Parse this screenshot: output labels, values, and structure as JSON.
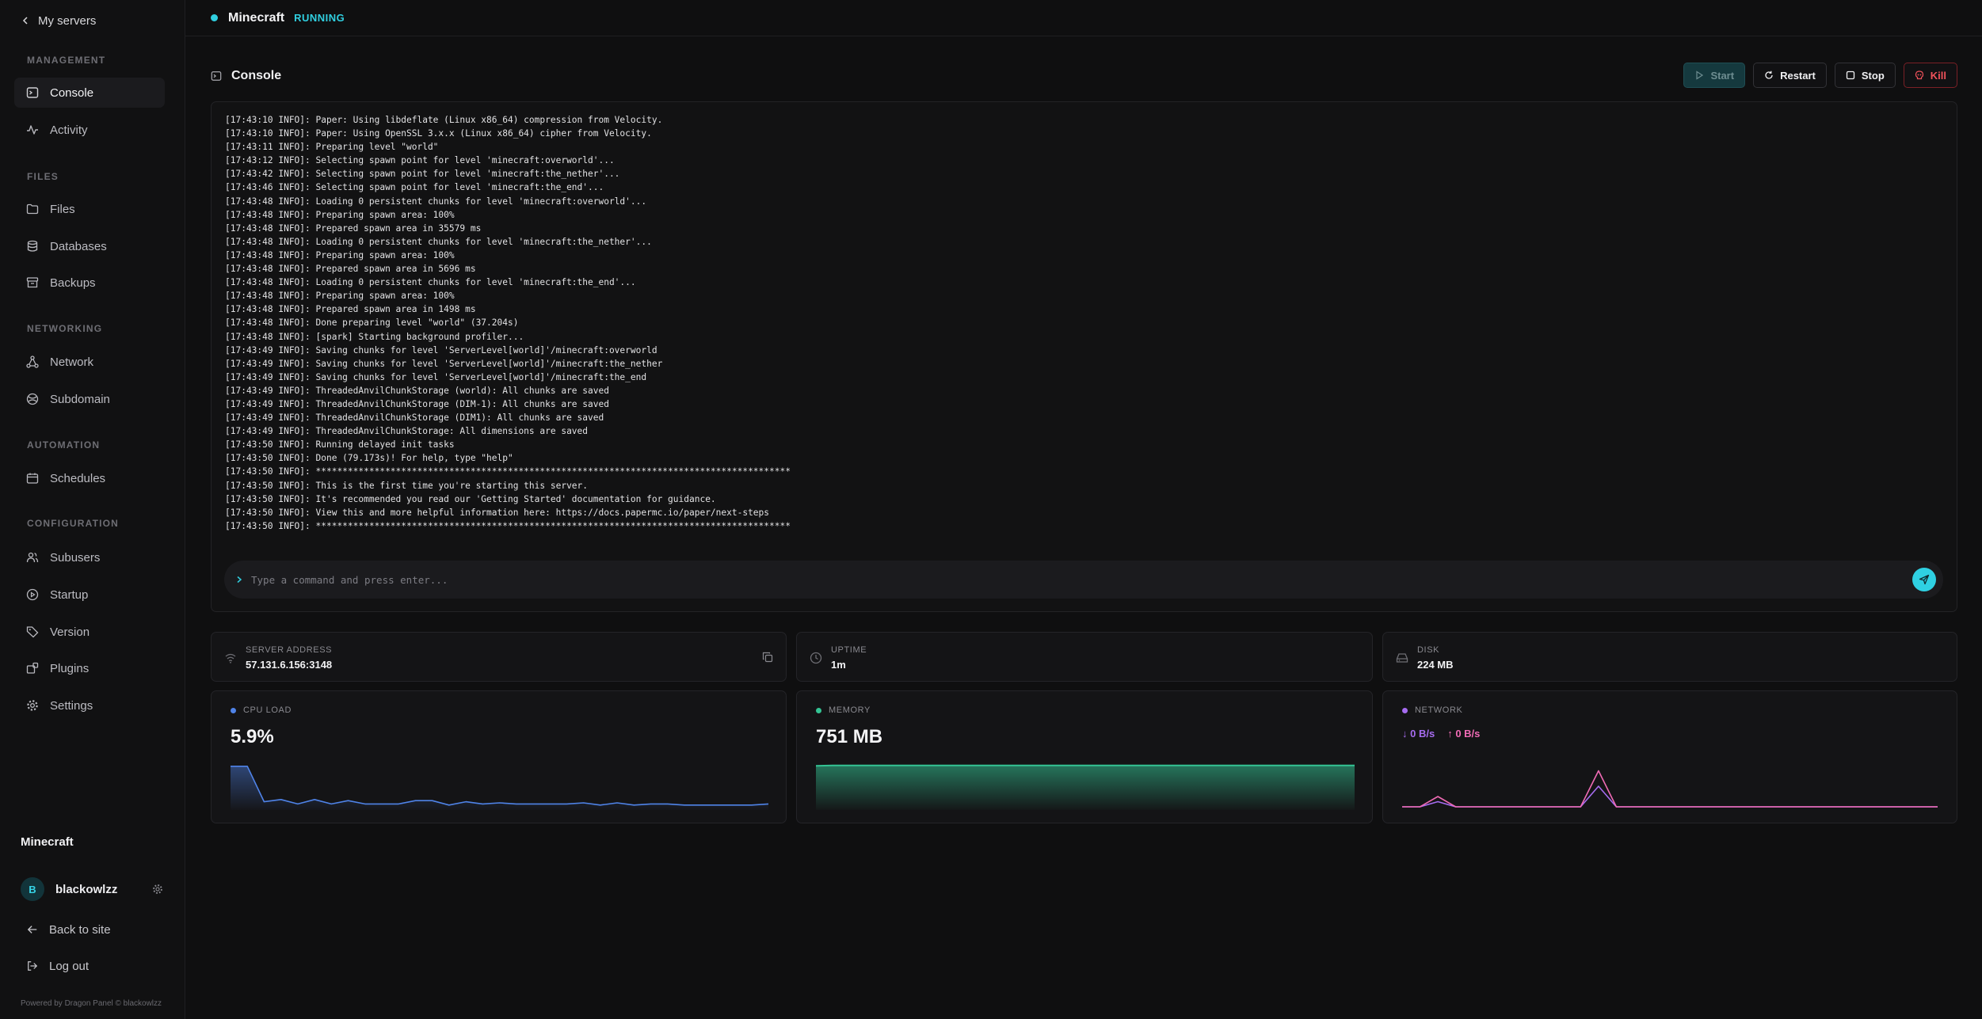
{
  "sidebar": {
    "back_label": "My servers",
    "sections": {
      "management": "MANAGEMENT",
      "files": "FILES",
      "networking": "NETWORKING",
      "automation": "AUTOMATION",
      "configuration": "CONFIGURATION"
    },
    "items": {
      "console": "Console",
      "activity": "Activity",
      "files": "Files",
      "databases": "Databases",
      "backups": "Backups",
      "network": "Network",
      "subdomain": "Subdomain",
      "schedules": "Schedules",
      "subusers": "Subusers",
      "startup": "Startup",
      "version": "Version",
      "plugins": "Plugins",
      "settings": "Settings"
    },
    "server_name": "Minecraft",
    "user": {
      "initial": "B",
      "name": "blackowlzz"
    },
    "back_to_site": "Back to site",
    "logout": "Log out",
    "powered_by": "Powered by Dragon Panel © blackowlzz"
  },
  "topbar": {
    "title": "Minecraft",
    "status": "RUNNING",
    "status_color": "#30cfe0"
  },
  "console": {
    "title": "Console",
    "buttons": {
      "start": "Start",
      "restart": "Restart",
      "stop": "Stop",
      "kill": "Kill"
    },
    "log": [
      "[17:43:10 INFO]: Paper: Using libdeflate (Linux x86_64) compression from Velocity.",
      "[17:43:10 INFO]: Paper: Using OpenSSL 3.x.x (Linux x86_64) cipher from Velocity.",
      "[17:43:11 INFO]: Preparing level \"world\"",
      "[17:43:12 INFO]: Selecting spawn point for level 'minecraft:overworld'...",
      "[17:43:42 INFO]: Selecting spawn point for level 'minecraft:the_nether'...",
      "[17:43:46 INFO]: Selecting spawn point for level 'minecraft:the_end'...",
      "[17:43:48 INFO]: Loading 0 persistent chunks for level 'minecraft:overworld'...",
      "[17:43:48 INFO]: Preparing spawn area: 100%",
      "[17:43:48 INFO]: Prepared spawn area in 35579 ms",
      "[17:43:48 INFO]: Loading 0 persistent chunks for level 'minecraft:the_nether'...",
      "[17:43:48 INFO]: Preparing spawn area: 100%",
      "[17:43:48 INFO]: Prepared spawn area in 5696 ms",
      "[17:43:48 INFO]: Loading 0 persistent chunks for level 'minecraft:the_end'...",
      "[17:43:48 INFO]: Preparing spawn area: 100%",
      "[17:43:48 INFO]: Prepared spawn area in 1498 ms",
      "[17:43:48 INFO]: Done preparing level \"world\" (37.204s)",
      "[17:43:48 INFO]: [spark] Starting background profiler...",
      "[17:43:49 INFO]: Saving chunks for level 'ServerLevel[world]'/minecraft:overworld",
      "[17:43:49 INFO]: Saving chunks for level 'ServerLevel[world]'/minecraft:the_nether",
      "[17:43:49 INFO]: Saving chunks for level 'ServerLevel[world]'/minecraft:the_end",
      "[17:43:49 INFO]: ThreadedAnvilChunkStorage (world): All chunks are saved",
      "[17:43:49 INFO]: ThreadedAnvilChunkStorage (DIM-1): All chunks are saved",
      "[17:43:49 INFO]: ThreadedAnvilChunkStorage (DIM1): All chunks are saved",
      "[17:43:49 INFO]: ThreadedAnvilChunkStorage: All dimensions are saved",
      "[17:43:50 INFO]: Running delayed init tasks",
      "[17:43:50 INFO]: Done (79.173s)! For help, type \"help\"",
      "[17:43:50 INFO]: *****************************************************************************************",
      "[17:43:50 INFO]: This is the first time you're starting this server.",
      "[17:43:50 INFO]: It's recommended you read our 'Getting Started' documentation for guidance.",
      "[17:43:50 INFO]: View this and more helpful information here: https://docs.papermc.io/paper/next-steps",
      "[17:43:50 INFO]: *****************************************************************************************"
    ],
    "command_placeholder": "Type a command and press enter..."
  },
  "info": {
    "address": {
      "label": "SERVER ADDRESS",
      "value": "57.131.6.156:3148"
    },
    "uptime": {
      "label": "UPTIME",
      "value": "1m"
    },
    "disk": {
      "label": "DISK",
      "value": "224 MB"
    }
  },
  "stats": {
    "cpu": {
      "label": "CPU LOAD",
      "value": "5.9%",
      "color": "#4f83e8",
      "series": [
        38,
        38,
        6,
        8,
        4,
        8,
        4,
        7,
        4,
        4,
        4,
        7,
        7,
        3,
        6,
        4,
        5,
        4,
        4,
        4,
        4,
        5,
        3,
        5,
        3,
        4,
        4,
        3,
        3,
        3,
        3,
        3,
        4
      ],
      "ymax": 40
    },
    "memory": {
      "label": "MEMORY",
      "value": "751 MB",
      "color": "#34c494",
      "series": [
        96,
        97,
        97,
        97,
        97,
        97,
        97,
        97,
        97,
        97,
        97,
        97,
        97,
        97,
        97,
        97,
        97,
        97,
        97,
        97,
        97,
        97,
        97,
        97,
        97,
        97,
        97,
        97,
        97,
        97,
        97,
        97,
        97
      ],
      "ymax": 100
    },
    "network": {
      "label": "NETWORK",
      "down": "0 B/s",
      "up": "0 B/s",
      "down_color": "#a66cf0",
      "up_color": "#f06bb5",
      "series_up": [
        0,
        0,
        4,
        0,
        0,
        0,
        0,
        0,
        0,
        0,
        0,
        14,
        0,
        0,
        0,
        0,
        0,
        0,
        0,
        0,
        0,
        0,
        0,
        0,
        0,
        0,
        0,
        0,
        0,
        0,
        0
      ],
      "series_down": [
        0,
        0,
        2,
        0,
        0,
        0,
        0,
        0,
        0,
        0,
        0,
        8,
        0,
        0,
        0,
        0,
        0,
        0,
        0,
        0,
        0,
        0,
        0,
        0,
        0,
        0,
        0,
        0,
        0,
        0,
        0
      ],
      "ymax": 16
    }
  }
}
